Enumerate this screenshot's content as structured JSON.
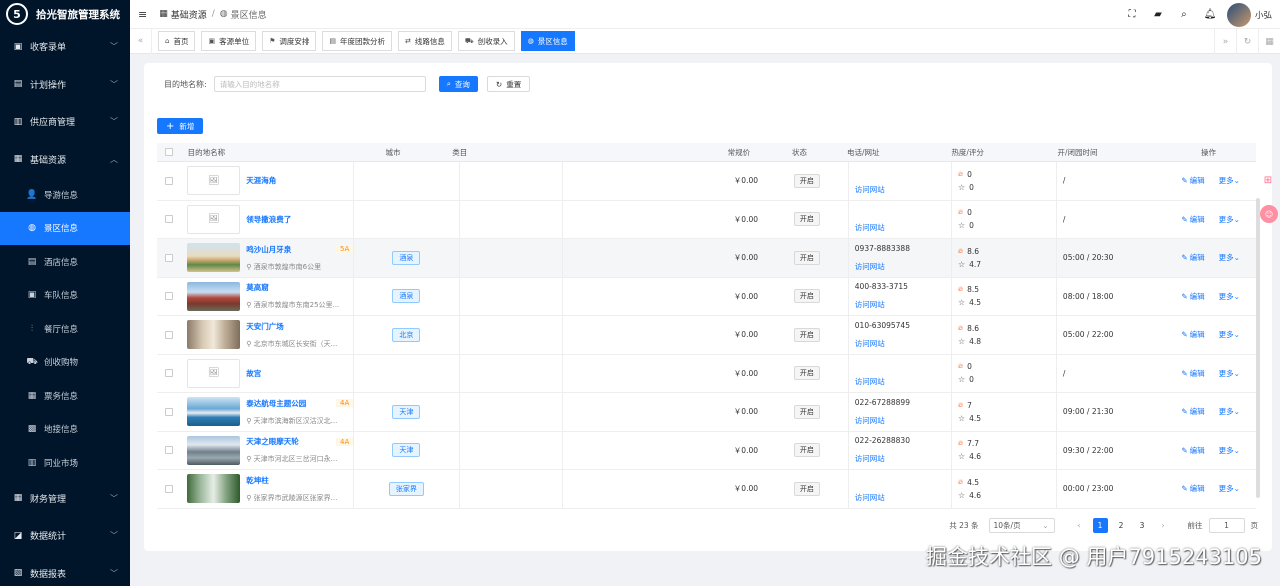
{
  "app": {
    "title": "拾光智旅管理系统",
    "logo_text": "5"
  },
  "user": {
    "name": "小弘"
  },
  "breadcrumb": {
    "parent": "基础资源",
    "current": "景区信息"
  },
  "sidebar": {
    "groups_top": [
      {
        "label": "收客录单",
        "icon": "clipboard-icon"
      },
      {
        "label": "计划操作",
        "icon": "bus-icon"
      },
      {
        "label": "供应商管理",
        "icon": "supplier-icon"
      }
    ],
    "base": {
      "label": "基础资源",
      "icon": "grid-icon"
    },
    "subs": [
      {
        "label": "导游信息",
        "icon": "person-icon",
        "glyph": "👤"
      },
      {
        "label": "景区信息",
        "icon": "globe-icon",
        "glyph": "◍"
      },
      {
        "label": "酒店信息",
        "icon": "hotel-icon",
        "glyph": "▤"
      },
      {
        "label": "车队信息",
        "icon": "car-icon",
        "glyph": "▣"
      },
      {
        "label": "餐厅信息",
        "icon": "restaurant-icon",
        "glyph": "⫶"
      },
      {
        "label": "创收购物",
        "icon": "cart-icon",
        "glyph": "⛟"
      },
      {
        "label": "票务信息",
        "icon": "ticket-icon",
        "glyph": "▦"
      },
      {
        "label": "地接信息",
        "icon": "local-icon",
        "glyph": "▩"
      },
      {
        "label": "同业市场",
        "icon": "market-icon",
        "glyph": "▥"
      }
    ],
    "groups_bottom": [
      {
        "label": "财务管理",
        "icon": "finance-icon"
      },
      {
        "label": "数据统计",
        "icon": "chart-icon"
      },
      {
        "label": "数据报表",
        "icon": "report-icon"
      }
    ]
  },
  "tabs": [
    {
      "label": "首页",
      "icon": "home-icon"
    },
    {
      "label": "客源单位",
      "icon": "unit-icon"
    },
    {
      "label": "调度安排",
      "icon": "dispatch-icon"
    },
    {
      "label": "年度团款分析",
      "icon": "calendar-icon"
    },
    {
      "label": "线路信息",
      "icon": "route-icon"
    },
    {
      "label": "创收录入",
      "icon": "cart-icon"
    },
    {
      "label": "景区信息",
      "icon": "globe-icon"
    }
  ],
  "search": {
    "label": "目的地名称:",
    "placeholder": "请输入目的地名称",
    "query_label": "查询",
    "reset_label": "重置"
  },
  "add_label": "新增",
  "table": {
    "headers": {
      "name": "目的地名称",
      "city": "城市",
      "category": "类目",
      "price": "常规价",
      "status": "状态",
      "tel": "电话/网址",
      "heat": "热度/评分",
      "time": "开/闭园时间",
      "ops": "操作"
    },
    "rows": [
      {
        "name": "天涯海角",
        "grade": "",
        "addr": "",
        "city": "",
        "price": "￥0.00",
        "status": "开启",
        "tel": "",
        "link": "访问网站",
        "heat": "0",
        "score": "0",
        "time": "/",
        "img": ""
      },
      {
        "name": "领导撒浪费了",
        "grade": "",
        "addr": "",
        "city": "",
        "price": "￥0.00",
        "status": "开启",
        "tel": "",
        "link": "访问网站",
        "heat": "0",
        "score": "0",
        "time": "/",
        "img": ""
      },
      {
        "name": "鸣沙山月牙泉",
        "grade": "5A",
        "addr": "酒泉市敦煌市南6公里",
        "city": "酒泉",
        "price": "￥0.00",
        "status": "开启",
        "tel": "0937-8883388",
        "link": "访问网站",
        "heat": "8.6",
        "score": "4.7",
        "time": "05:00 / 20:30",
        "img": "desert"
      },
      {
        "name": "莫高窟",
        "grade": "",
        "addr": "酒泉市敦煌市东南25公里...",
        "city": "酒泉",
        "price": "￥0.00",
        "status": "开启",
        "tel": "400-833-3715",
        "link": "访问网站",
        "heat": "8.5",
        "score": "4.5",
        "time": "08:00 / 18:00",
        "img": "temple"
      },
      {
        "name": "天安门广场",
        "grade": "",
        "addr": "北京市东城区长安街（天...",
        "city": "北京",
        "price": "￥0.00",
        "status": "开启",
        "tel": "010-63095745",
        "link": "访问网站",
        "heat": "8.6",
        "score": "4.8",
        "time": "05:00 / 22:00",
        "img": "hall"
      },
      {
        "name": "故宫",
        "grade": "",
        "addr": "",
        "city": "",
        "price": "￥0.00",
        "status": "开启",
        "tel": "",
        "link": "访问网站",
        "heat": "0",
        "score": "0",
        "time": "/",
        "img": ""
      },
      {
        "name": "泰达航母主题公园",
        "grade": "4A",
        "addr": "天津市滨海新区汉沽汉北...",
        "city": "天津",
        "price": "￥0.00",
        "status": "开启",
        "tel": "022-67288899",
        "link": "访问网站",
        "heat": "7",
        "score": "4.5",
        "time": "09:00 / 21:30",
        "img": "sea"
      },
      {
        "name": "天津之眼摩天轮",
        "grade": "4A",
        "addr": "天津市河北区三岔河口永...",
        "city": "天津",
        "price": "￥0.00",
        "status": "开启",
        "tel": "022-26288830",
        "link": "访问网站",
        "heat": "7.7",
        "score": "4.6",
        "time": "09:30 / 22:00",
        "img": "city"
      },
      {
        "name": "乾坤柱",
        "grade": "",
        "addr": "张家界市武陵源区张家界...",
        "city": "张家界",
        "price": "￥0.00",
        "status": "开启",
        "tel": "",
        "link": "访问网站",
        "heat": "4.5",
        "score": "4.6",
        "time": "00:00 / 23:00",
        "img": "mountain"
      }
    ],
    "edit_label": "编辑",
    "more_label": "更多"
  },
  "pagination": {
    "total": "共 23 条",
    "size": "10条/页",
    "pages": [
      "1",
      "2",
      "3"
    ],
    "current": "1",
    "goto": "前往",
    "goto_value": "1",
    "page_unit": "页"
  },
  "watermark": "掘金技术社区 @ 用户7915243105",
  "colors": {
    "primary": "#1677ff",
    "sidebar": "#001529",
    "orange": "#fa8c16",
    "fire": "#fa541c"
  }
}
